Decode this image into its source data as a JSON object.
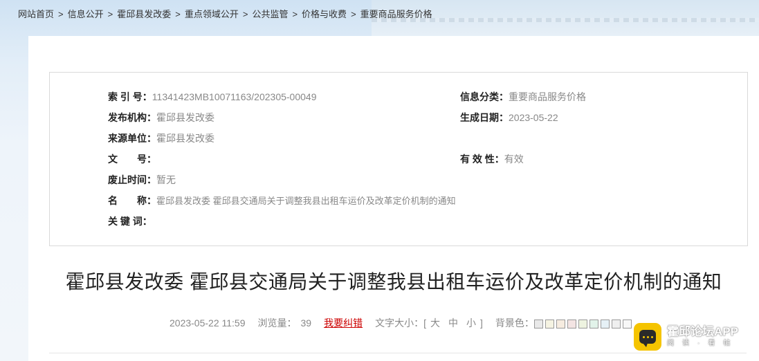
{
  "breadcrumb": [
    "网站首页",
    "信息公开",
    "霍邱县发改委",
    "重点领域公开",
    "公共监管",
    "价格与收费",
    "重要商品服务价格"
  ],
  "breadcrumb_separator": ">",
  "meta": {
    "index_label": "索 引 号：",
    "index_value": "11341423MB10071163/202305-00049",
    "category_label": "信息分类：",
    "category_value": "重要商品服务价格",
    "publisher_label": "发布机构：",
    "publisher_value": "霍邱县发改委",
    "date_label": "生成日期：",
    "date_value": "2023-05-22",
    "source_label": "来源单位：",
    "source_value": "霍邱县发改委",
    "docno_label": "文　　号：",
    "docno_value": "",
    "validity_label": "有 效 性：",
    "validity_value": "有效",
    "expiry_label": "废止时间：",
    "expiry_value": "暂无",
    "name_label": "名　　称：",
    "name_value": "霍邱县发改委 霍邱县交通局关于调整我县出租车运价及改革定价机制的通知",
    "keywords_label": "关 键 词：",
    "keywords_value": ""
  },
  "article": {
    "title": "霍邱县发改委 霍邱县交通局关于调整我县出租车运价及改革定价机制的通知",
    "datetime": "2023-05-22 11:59",
    "views_label": "浏览量：",
    "views_value": "39",
    "report_link": "我要纠错",
    "font_size_label": "文字大小：[",
    "font_large": "大",
    "font_medium": "中",
    "font_small": "小",
    "font_close": "]",
    "bg_label": "背景色："
  },
  "bg_swatches": [
    "#e9e9e9",
    "#f5f3e2",
    "#f6ece0",
    "#f3e4e3",
    "#eef3e0",
    "#e2f3ea",
    "#e6f1f6",
    "#efefef",
    "#f7f7f7"
  ],
  "app_badge": {
    "name": "霍邱论坛APP",
    "sub": "阅读·看帖"
  }
}
